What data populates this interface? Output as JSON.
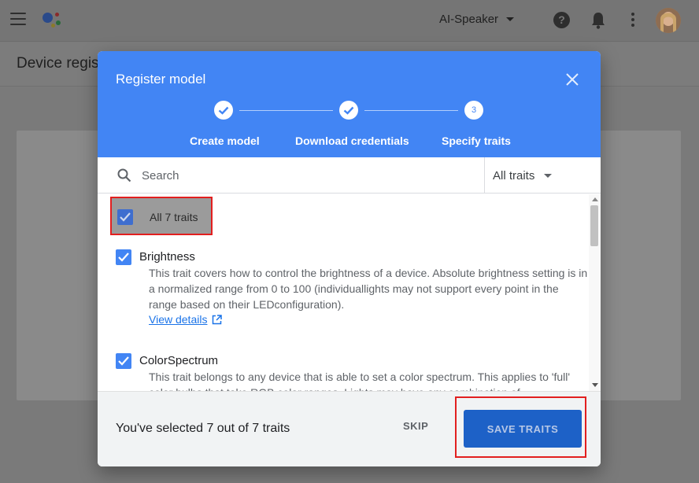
{
  "topbar": {
    "project_name": "AI-Speaker",
    "icons": [
      "menu-icon",
      "google-assistant-logo",
      "help-icon",
      "bell-icon",
      "more-vert-icon",
      "avatar"
    ]
  },
  "background": {
    "page_title": "Device regist"
  },
  "dialog": {
    "title": "Register model",
    "steps": [
      {
        "label": "Create model",
        "status": "complete"
      },
      {
        "label": "Download credentials",
        "status": "complete"
      },
      {
        "label": "Specify traits",
        "status": "active",
        "number": "3"
      }
    ],
    "search": {
      "placeholder": "Search",
      "filter_value": "All traits"
    },
    "all_traits_label": "All 7 traits",
    "traits": [
      {
        "name": "Brightness",
        "checked": true,
        "description": "This trait covers how to control the brightness of a device. Absolute brightness setting is in a normalized range from 0 to 100 (individuallights may not support every point in the range based on their LEDconfiguration).",
        "link": "View details"
      },
      {
        "name": "ColorSpectrum",
        "checked": true,
        "description": "This trait belongs to any device that is able to set a color spectrum. This applies to 'full' color bulbs that take RGB color ranges. Lights may have any combination of"
      }
    ],
    "footer": {
      "selection_text": "You've selected 7 out of 7 traits",
      "skip_label": "SKIP",
      "save_label": "SAVE TRAITS"
    }
  },
  "colors": {
    "header_blue": "#4285f4",
    "checkbox_blue": "#4285f4",
    "save_button": "#1d61c7",
    "highlight_red": "#e21f1f"
  }
}
